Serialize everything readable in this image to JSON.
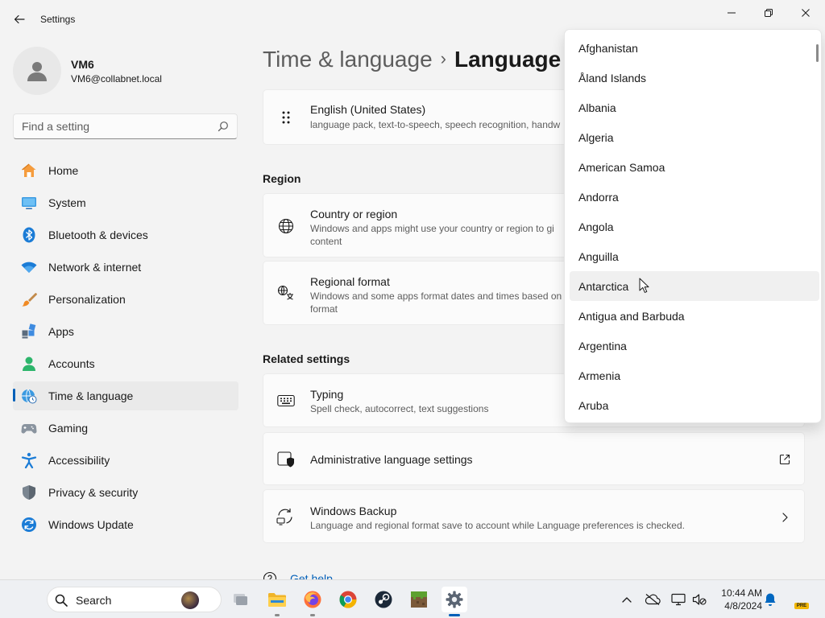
{
  "window": {
    "title": "Settings"
  },
  "user": {
    "name": "VM6",
    "email": "VM6@collabnet.local"
  },
  "search": {
    "placeholder": "Find a setting"
  },
  "nav": {
    "items": [
      {
        "label": "Home",
        "icon": "home-icon",
        "selected": false
      },
      {
        "label": "System",
        "icon": "monitor-icon",
        "selected": false
      },
      {
        "label": "Bluetooth & devices",
        "icon": "bluetooth-icon",
        "selected": false
      },
      {
        "label": "Network & internet",
        "icon": "wifi-icon",
        "selected": false
      },
      {
        "label": "Personalization",
        "icon": "brush-icon",
        "selected": false
      },
      {
        "label": "Apps",
        "icon": "apps-icon",
        "selected": false
      },
      {
        "label": "Accounts",
        "icon": "accounts-icon",
        "selected": false
      },
      {
        "label": "Time & language",
        "icon": "time-language-icon",
        "selected": true
      },
      {
        "label": "Gaming",
        "icon": "controller-icon",
        "selected": false
      },
      {
        "label": "Accessibility",
        "icon": "accessibility-icon",
        "selected": false
      },
      {
        "label": "Privacy & security",
        "icon": "shield-icon",
        "selected": false
      },
      {
        "label": "Windows Update",
        "icon": "update-icon",
        "selected": false
      }
    ]
  },
  "header": {
    "parent": "Time & language",
    "separator": "›",
    "current": "Language"
  },
  "language_card": {
    "title": "English (United States)",
    "description": "language pack, text-to-speech, speech recognition, handw"
  },
  "sections": {
    "region": "Region",
    "related": "Related settings"
  },
  "region_cards": {
    "country": {
      "title": "Country or region",
      "description_line1": "Windows and apps might use your country or region to gi",
      "description_line2": "content"
    },
    "format": {
      "title": "Regional format",
      "description_line1": "Windows and some apps format dates and times based on",
      "description_line2": "format"
    }
  },
  "related_cards": {
    "typing": {
      "title": "Typing",
      "description": "Spell check, autocorrect, text suggestions"
    },
    "admin": {
      "title": "Administrative language settings"
    },
    "backup": {
      "title": "Windows Backup",
      "description": "Language and regional format save to account while Language preferences is checked."
    }
  },
  "help": {
    "label": "Get help"
  },
  "dropdown": {
    "hovered_index": 8,
    "countries": [
      "Afghanistan",
      "Åland Islands",
      "Albania",
      "Algeria",
      "American Samoa",
      "Andorra",
      "Angola",
      "Anguilla",
      "Antarctica",
      "Antigua and Barbuda",
      "Argentina",
      "Armenia",
      "Aruba"
    ]
  },
  "taskbar": {
    "search_label": "Search",
    "apps": [
      "Task View",
      "File Explorer",
      "Firefox",
      "Chrome",
      "Steam",
      "Minecraft",
      "Settings"
    ],
    "clock": {
      "time": "10:44 AM",
      "date": "4/8/2024"
    },
    "badge": "PRE"
  },
  "colors": {
    "accent": "#005fb8",
    "background": "#f3f3f3",
    "card": "#fbfbfb"
  }
}
